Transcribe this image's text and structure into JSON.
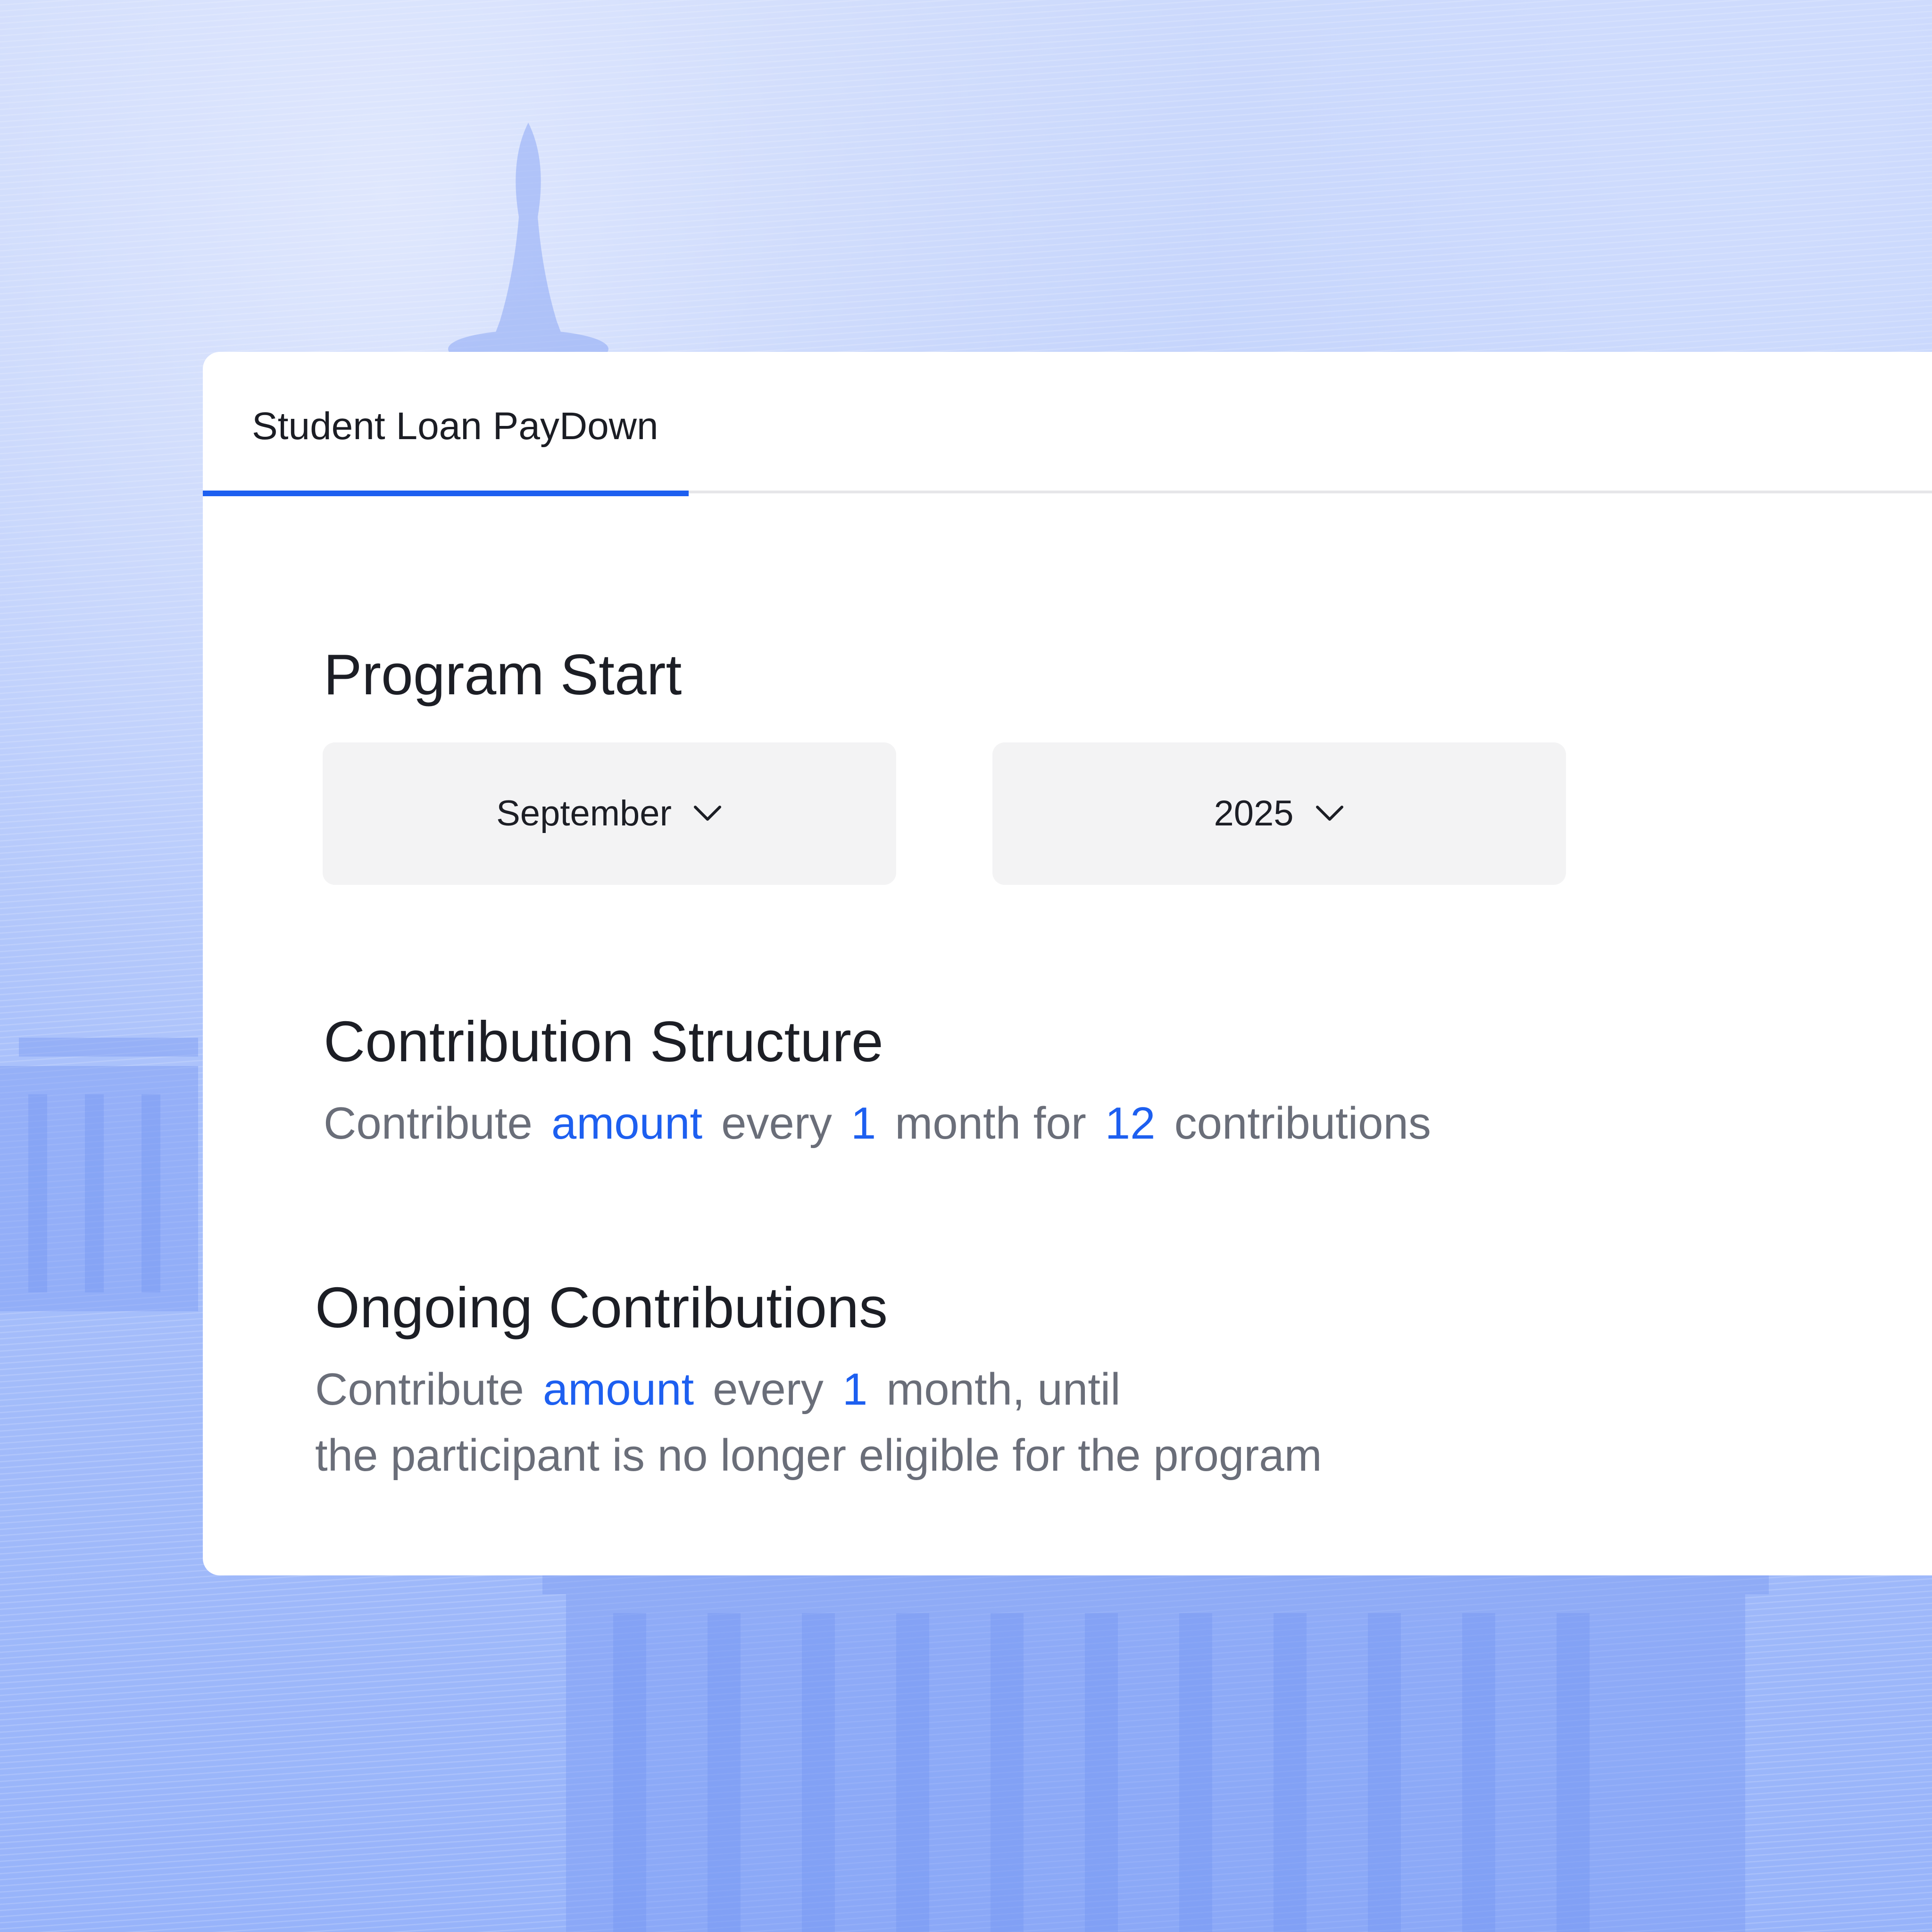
{
  "tab": {
    "label": "Student Loan PayDown"
  },
  "program_start": {
    "title": "Program Start",
    "month": "September",
    "year": "2025"
  },
  "contribution_structure": {
    "title": "Contribution Structure",
    "w1": "Contribute",
    "amount": "amount",
    "w2": "every",
    "interval": "1",
    "w3": "month for",
    "count": "12",
    "w4": "contributions"
  },
  "ongoing_contributions": {
    "title": "Ongoing Contributions",
    "w1": "Contribute",
    "amount": "amount",
    "w2": "every",
    "interval": "1",
    "w3": "month, until",
    "line2": "the participant is no longer eligible for the program"
  },
  "colors": {
    "accent": "#1d5ff0",
    "background": "#a9c0fb",
    "field": "#f3f3f4"
  },
  "icons": [
    "chevron-down-icon"
  ]
}
